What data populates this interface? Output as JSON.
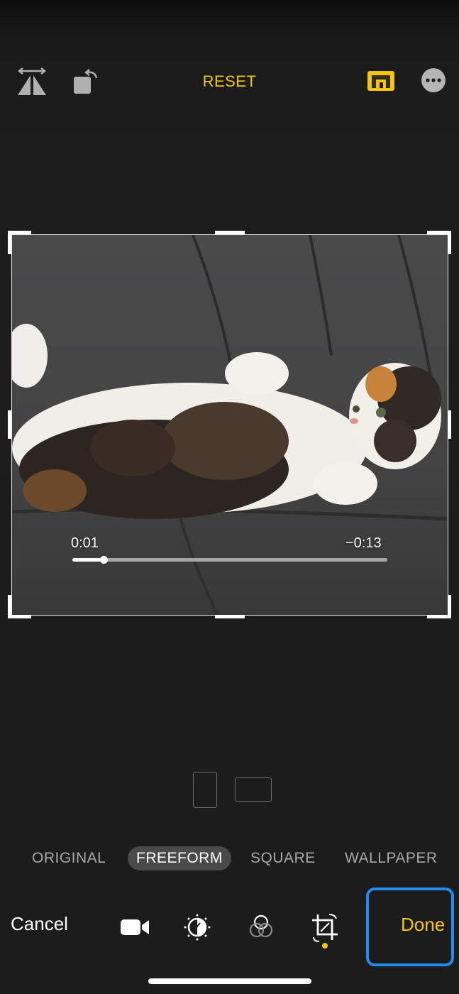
{
  "toolbar": {
    "flip_icon": "flip-horizontal-icon",
    "rotate_icon": "rotate-left-icon",
    "reset_label": "RESET",
    "aspect_icon": "aspect-ratio-icon",
    "more_icon": "more-ellipsis-icon"
  },
  "video": {
    "elapsed": "0:01",
    "remaining": "−0:13",
    "progress": 0.1
  },
  "orientation": {
    "portrait_icon": "portrait-orientation-icon",
    "landscape_icon": "landscape-orientation-icon"
  },
  "aspect_options": {
    "original": "ORIGINAL",
    "freeform": "FREEFORM",
    "square": "SQUARE",
    "wallpaper": "WALLPAPER",
    "selected": "FREEFORM"
  },
  "bottom": {
    "cancel_label": "Cancel",
    "done_label": "Done",
    "tools": [
      "video-camera-icon",
      "adjust-dial-icon",
      "filters-icon",
      "crop-rotate-icon"
    ],
    "active_tool": "crop-rotate-icon"
  },
  "colors": {
    "accent": "#f2c511",
    "highlight": "#1e8cf0",
    "background": "#1c1c1c"
  }
}
